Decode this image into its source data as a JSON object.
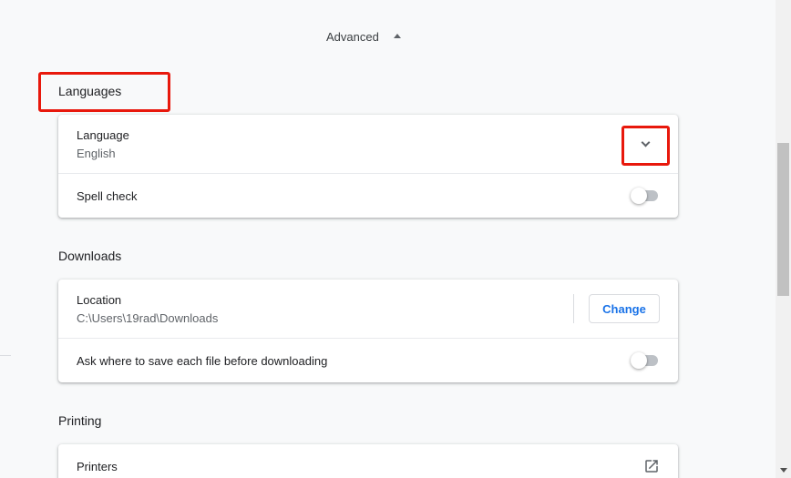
{
  "advanced": {
    "label": "Advanced"
  },
  "languages": {
    "title": "Languages",
    "language_label": "Language",
    "language_value": "English",
    "spellcheck_label": "Spell check"
  },
  "downloads": {
    "title": "Downloads",
    "location_label": "Location",
    "location_value": "C:\\Users\\19rad\\Downloads",
    "change_label": "Change",
    "ask_label": "Ask where to save each file before downloading"
  },
  "printing": {
    "title": "Printing",
    "printers_label": "Printers"
  },
  "icons": {
    "advanced": "triangle-up-icon",
    "language_expand": "chevron-down-icon",
    "printers": "open-in-new-icon"
  },
  "colors": {
    "highlight": "#e8180c",
    "accent": "#1a73e8",
    "background": "#f8f9fa"
  }
}
